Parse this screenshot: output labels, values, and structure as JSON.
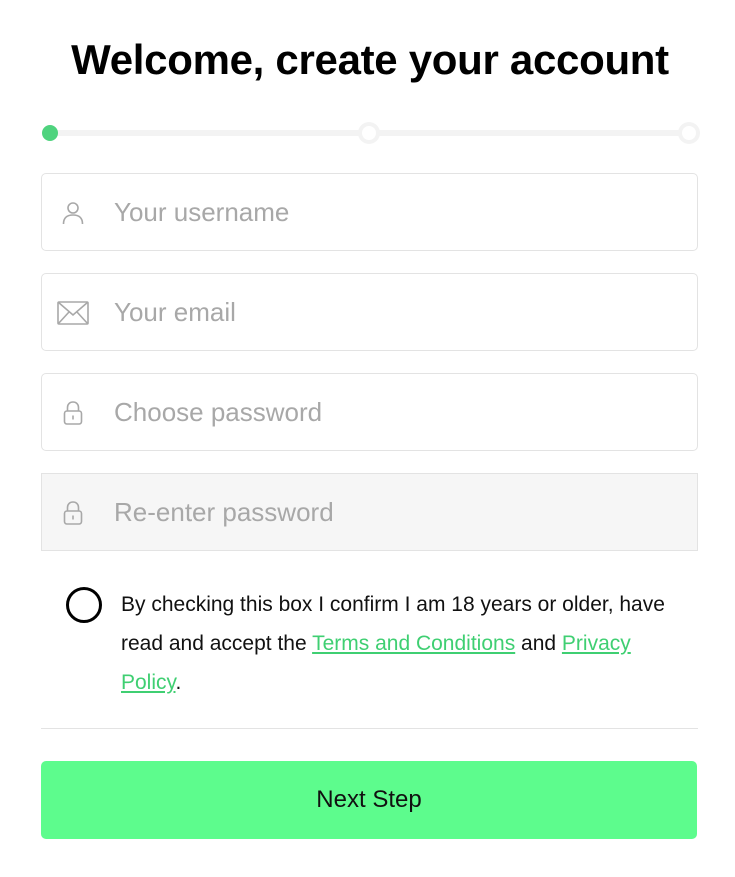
{
  "title": "Welcome, create your account",
  "stepper": {
    "steps": 3,
    "current_step": 1
  },
  "fields": {
    "username": {
      "placeholder": "Your username",
      "value": "",
      "icon": "user-icon"
    },
    "email": {
      "placeholder": "Your email",
      "value": "",
      "icon": "envelope-icon"
    },
    "password": {
      "placeholder": "Choose password",
      "value": "",
      "icon": "lock-icon"
    },
    "confirm_password": {
      "placeholder": "Re-enter password",
      "value": "",
      "icon": "lock-icon"
    }
  },
  "consent": {
    "checked": false,
    "text_before": "By checking this box I confirm I am 18 years or older, have read and accept the ",
    "terms_link": "Terms and Conditions",
    "text_between": " and ",
    "privacy_link": "Privacy Policy",
    "text_after": "."
  },
  "next_button": "Next Step",
  "colors": {
    "accent": "#5dfc8d",
    "link": "#3fcf72",
    "step_active": "#4fd37e"
  }
}
